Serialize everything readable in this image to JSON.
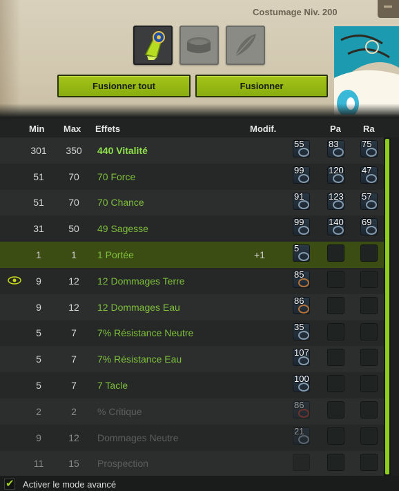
{
  "header": {
    "level_label": "Costumage Niv. 200",
    "slots": [
      {
        "name": "costume-item",
        "active": true
      },
      {
        "name": "hat-item",
        "active": false
      },
      {
        "name": "feather-item",
        "active": false
      }
    ],
    "fuse_all_label": "Fusionner tout",
    "fuse_label": "Fusionner"
  },
  "columns": {
    "min": "Min",
    "max": "Max",
    "effects": "Effets",
    "modif": "Modif.",
    "pa": "Pa",
    "ra": "Ra"
  },
  "rows": [
    {
      "min": "301",
      "max": "350",
      "effect": "440 Vitalité",
      "modif": "",
      "ba": "55",
      "pa": "83",
      "ra": "75",
      "style": "main"
    },
    {
      "min": "51",
      "max": "70",
      "effect": "70 Force",
      "modif": "",
      "ba": "99",
      "pa": "120",
      "ra": "47",
      "style": "normal"
    },
    {
      "min": "51",
      "max": "70",
      "effect": "70 Chance",
      "modif": "",
      "ba": "91",
      "pa": "123",
      "ra": "57",
      "style": "normal"
    },
    {
      "min": "31",
      "max": "50",
      "effect": "49 Sagesse",
      "modif": "",
      "ba": "99",
      "pa": "140",
      "ra": "69",
      "style": "normal"
    },
    {
      "min": "1",
      "max": "1",
      "effect": "1 Portée",
      "modif": "+1",
      "ba": "5",
      "pa": "",
      "ra": "",
      "style": "highlight"
    },
    {
      "min": "9",
      "max": "12",
      "effect": "12 Dommages Terre",
      "modif": "",
      "ba": "85",
      "pa": "",
      "ra": "",
      "style": "normal",
      "eye": true
    },
    {
      "min": "9",
      "max": "12",
      "effect": "12 Dommages Eau",
      "modif": "",
      "ba": "86",
      "pa": "",
      "ra": "",
      "style": "normal"
    },
    {
      "min": "5",
      "max": "7",
      "effect": "7% Résistance Neutre",
      "modif": "",
      "ba": "35",
      "pa": "",
      "ra": "",
      "style": "normal"
    },
    {
      "min": "5",
      "max": "7",
      "effect": "7% Résistance Eau",
      "modif": "",
      "ba": "107",
      "pa": "",
      "ra": "",
      "style": "normal"
    },
    {
      "min": "5",
      "max": "7",
      "effect": "7 Tacle",
      "modif": "",
      "ba": "100",
      "pa": "",
      "ra": "",
      "style": "normal"
    },
    {
      "min": "2",
      "max": "2",
      "effect": "% Critique",
      "modif": "",
      "ba": "86",
      "pa": "",
      "ra": "",
      "style": "dim"
    },
    {
      "min": "9",
      "max": "12",
      "effect": " Dommages Neutre",
      "modif": "",
      "ba": "21",
      "pa": "",
      "ra": "",
      "style": "dim"
    },
    {
      "min": "11",
      "max": "15",
      "effect": " Prospection",
      "modif": "",
      "ba": "",
      "pa": "",
      "ra": "",
      "style": "dim"
    }
  ],
  "footer": {
    "advanced_mode_label": "Activer le mode avancé",
    "advanced_mode_checked": true
  },
  "colors": {
    "accent": "#8fcf1b",
    "effect_text": "#7fbf3b",
    "highlight_row": "#3c4d14"
  }
}
